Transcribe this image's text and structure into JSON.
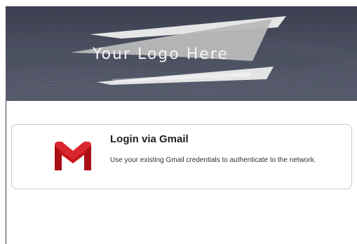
{
  "banner": {
    "logo_text": "Your Logo Here",
    "background_color": "#464b5c"
  },
  "login_option": {
    "title": "Login via Gmail",
    "description": "Use your existing Gmail credentials to authenticate to the network.",
    "icon": "gmail-icon"
  },
  "colors": {
    "gmail_red": "#c8151b",
    "card_border": "#c9c9c9"
  }
}
